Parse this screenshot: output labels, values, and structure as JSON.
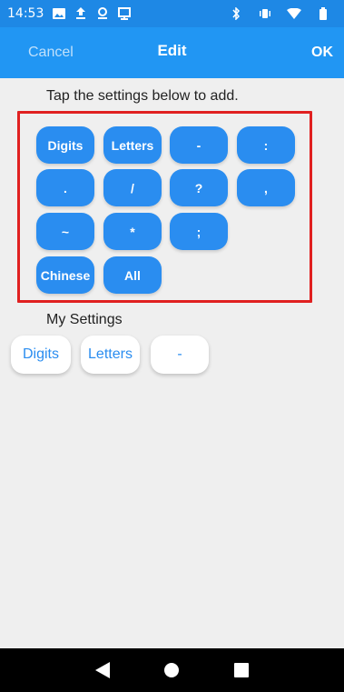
{
  "status": {
    "time": "14:53",
    "left_icons": [
      "image-icon",
      "upload-icon",
      "location-icon",
      "screencast-icon"
    ],
    "right_icons": [
      "bluetooth-icon",
      "vibrate-icon",
      "wifi-icon",
      "battery-icon"
    ]
  },
  "appbar": {
    "cancel_label": "Cancel",
    "title": "Edit",
    "ok_label": "OK"
  },
  "hint": "Tap the settings below to add.",
  "available": [
    {
      "label": "Digits"
    },
    {
      "label": "Letters"
    },
    {
      "label": "-"
    },
    {
      "label": ":"
    },
    {
      "label": "."
    },
    {
      "label": "/"
    },
    {
      "label": "?"
    },
    {
      "label": ","
    },
    {
      "label": "~"
    },
    {
      "label": "*"
    },
    {
      "label": ";"
    },
    {
      "label": "Chinese"
    },
    {
      "label": "All"
    }
  ],
  "my_settings_label": "My Settings",
  "my_settings": [
    {
      "label": "Digits"
    },
    {
      "label": "Letters"
    },
    {
      "label": "-"
    }
  ],
  "colors": {
    "primary": "#2196f3",
    "chip": "#2a8df0",
    "highlight_frame": "#e02020",
    "background": "#efefef"
  }
}
